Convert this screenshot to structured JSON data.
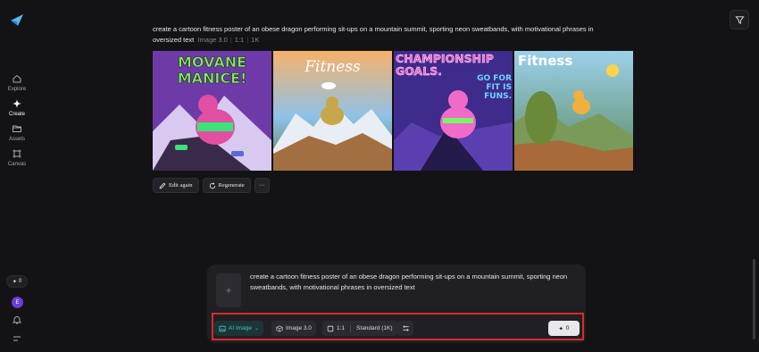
{
  "sidebar": {
    "items": [
      {
        "label": "Explore",
        "icon": "home-icon"
      },
      {
        "label": "Create",
        "icon": "sparkle-icon"
      },
      {
        "label": "Assets",
        "icon": "folder-icon"
      },
      {
        "label": "Canvas",
        "icon": "canvas-icon"
      }
    ],
    "credits": "0",
    "avatar_letter": "E"
  },
  "prompt": {
    "text": "create a cartoon fitness poster of an obese dragon performing sit-ups on a mountain summit, sporting neon sweatbands, with motivational phrases in oversized text",
    "model": "Image 3.0",
    "ratio": "1:1",
    "resolution": "1K"
  },
  "images": [
    {
      "title_line1": "MOVANE",
      "title_line2": "MANICE!",
      "bg": "#6e3aa8"
    },
    {
      "title_line1": "Fitness",
      "bg": "#f2a05a"
    },
    {
      "title_line1": "CHAMPIONSHIP",
      "title_line2": "GOALS.",
      "side": "GO FOR FIT IS FUNS.",
      "bg": "#3f2b8c"
    },
    {
      "title_line1": "Fitness",
      "bg": "#7ab6d8"
    }
  ],
  "actions": {
    "edit_again": "Edit again",
    "regenerate": "Regenerate",
    "more": "···"
  },
  "composer": {
    "text": "create a cartoon fitness poster of an obese dragon performing sit-ups on a mountain summit, sporting neon sweatbands, with motivational phrases in oversized text",
    "mode": "AI Image",
    "model": "Image 3.0",
    "ratio": "1:1",
    "quality": "Standard (1K)",
    "send_credits": "0"
  },
  "colors": {
    "accent_teal": "#3ec9c0",
    "highlight_red": "#d92b2b",
    "background": "#131316"
  }
}
